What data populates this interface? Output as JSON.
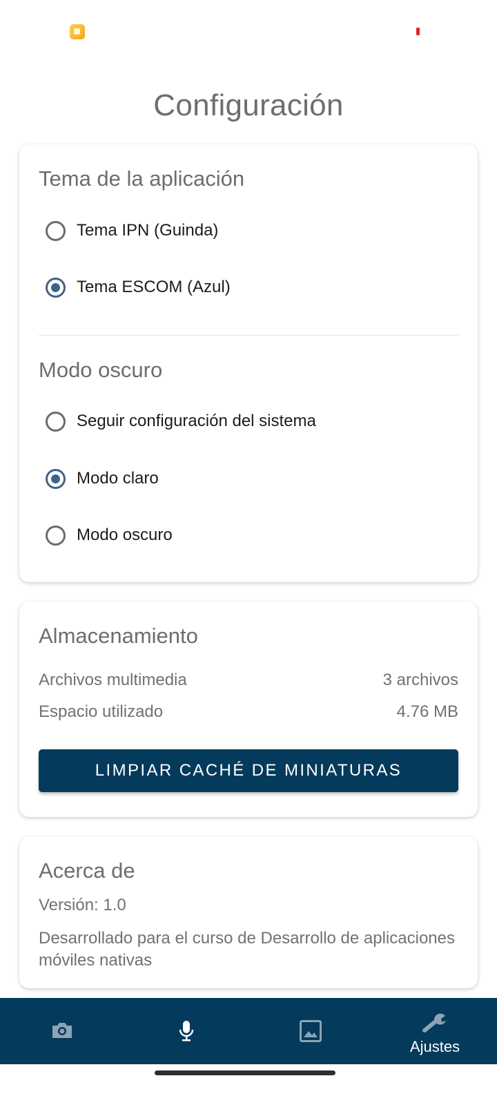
{
  "page_title": "Configuración",
  "theme_section": {
    "title": "Tema de la aplicación",
    "options": [
      {
        "label": "Tema IPN (Guinda)",
        "checked": false
      },
      {
        "label": "Tema ESCOM (Azul)",
        "checked": true
      }
    ]
  },
  "dark_mode_section": {
    "title": "Modo oscuro",
    "options": [
      {
        "label": "Seguir configuración del sistema",
        "checked": false
      },
      {
        "label": "Modo claro",
        "checked": true
      },
      {
        "label": "Modo oscuro",
        "checked": false
      }
    ]
  },
  "storage": {
    "title": "Almacenamiento",
    "media_label": "Archivos multimedia",
    "media_value": "3 archivos",
    "space_label": "Espacio utilizado",
    "space_value": "4.76 MB",
    "clear_button": "LIMPIAR CACHÉ DE MINIATURAS"
  },
  "about": {
    "title": "Acerca de",
    "version": "Versión: 1.0",
    "description": "Desarrollado para el curso de Desarrollo de aplicaciones móviles nativas"
  },
  "bottom_nav": {
    "items": [
      {
        "icon": "camera-icon",
        "label": ""
      },
      {
        "icon": "microphone-icon",
        "label": ""
      },
      {
        "icon": "gallery-icon",
        "label": ""
      },
      {
        "icon": "wrench-icon",
        "label": "Ajustes",
        "active": true
      }
    ]
  },
  "colors": {
    "primary": "#043a5b",
    "radio_checked": "#3f6388",
    "inactive_nav_icon": "#8ea3b6"
  }
}
